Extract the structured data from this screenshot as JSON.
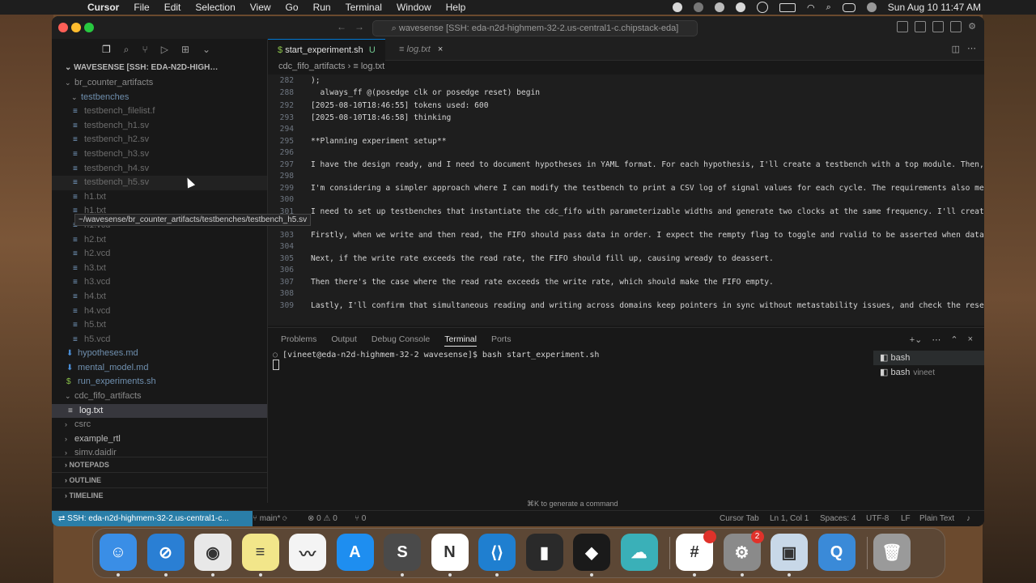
{
  "menubar": {
    "app": "Cursor",
    "items": [
      "File",
      "Edit",
      "Selection",
      "View",
      "Go",
      "Run",
      "Terminal",
      "Window",
      "Help"
    ],
    "clock": "Sun Aug 10  11:47 AM"
  },
  "window": {
    "command_center": "wavesense [SSH: eda-n2d-highmem-32-2.us-central1-c.chipstack-eda]"
  },
  "sidebar": {
    "header": "WAVESENSE [SSH: EDA-N2D-HIGH…",
    "tree": [
      {
        "label": "br_counter_artifacts",
        "type": "folder",
        "depth": 1,
        "open": true
      },
      {
        "label": "testbenches",
        "type": "folder",
        "depth": 2,
        "open": true
      },
      {
        "label": "testbench_filelist.f",
        "type": "file",
        "depth": 3
      },
      {
        "label": "testbench_h1.sv",
        "type": "file",
        "depth": 3
      },
      {
        "label": "testbench_h2.sv",
        "type": "file",
        "depth": 3
      },
      {
        "label": "testbench_h3.sv",
        "type": "file",
        "depth": 3
      },
      {
        "label": "testbench_h4.sv",
        "type": "file",
        "depth": 3
      },
      {
        "label": "testbench_h5.sv",
        "type": "file",
        "depth": 3
      },
      {
        "label": "h1.txt",
        "type": "file",
        "depth": 3
      },
      {
        "label": "h1.txt",
        "type": "file",
        "depth": 3
      },
      {
        "label": "h1.vcd",
        "type": "file",
        "depth": 3
      },
      {
        "label": "h2.txt",
        "type": "file",
        "depth": 3
      },
      {
        "label": "h2.vcd",
        "type": "file",
        "depth": 3
      },
      {
        "label": "h3.txt",
        "type": "file",
        "depth": 3
      },
      {
        "label": "h3.vcd",
        "type": "file",
        "depth": 3
      },
      {
        "label": "h4.txt",
        "type": "file",
        "depth": 3
      },
      {
        "label": "h4.vcd",
        "type": "file",
        "depth": 3
      },
      {
        "label": "h5.txt",
        "type": "file",
        "depth": 3
      },
      {
        "label": "h5.vcd",
        "type": "file",
        "depth": 3
      },
      {
        "label": "hypotheses.md",
        "type": "md",
        "depth": 2
      },
      {
        "label": "mental_model.md",
        "type": "md",
        "depth": 2
      },
      {
        "label": "run_experiments.sh",
        "type": "sh",
        "depth": 2
      },
      {
        "label": "cdc_fifo_artifacts",
        "type": "folder",
        "depth": 1,
        "open": true
      },
      {
        "label": "log.txt",
        "type": "file",
        "depth": 2,
        "selected": true
      },
      {
        "label": "csrc",
        "type": "folder",
        "depth": 1
      },
      {
        "label": "example_rtl",
        "type": "folder",
        "depth": 1
      },
      {
        "label": "simv.daidir",
        "type": "folder",
        "depth": 1
      }
    ],
    "tooltip": "~/wavesense/br_counter_artifacts/testbenches/testbench_h5.sv",
    "sections": [
      "NOTEPADS",
      "OUTLINE",
      "TIMELINE"
    ]
  },
  "tabs": [
    {
      "label": "start_experiment.sh",
      "status": "U"
    },
    {
      "label": "log.txt"
    }
  ],
  "breadcrumb": [
    "cdc_fifo_artifacts",
    "log.txt"
  ],
  "editor": {
    "lines": [
      {
        "n": "282",
        "text": ");"
      },
      {
        "n": "288",
        "text": "  always_ff @(posedge clk or posedge reset) begin"
      },
      {
        "n": "292",
        "text": "[2025-08-10T18:46:55] tokens used: 600"
      },
      {
        "n": "293",
        "text": "[2025-08-10T18:46:58] thinking"
      },
      {
        "n": "294",
        "text": ""
      },
      {
        "n": "295",
        "text": "**Planning experiment setup**"
      },
      {
        "n": "296",
        "text": ""
      },
      {
        "n": "297",
        "text": "I have the design ready, and I need to document hypotheses in YAML format. For each hypothesis, I'll create a testbench with a top module. Then, I"
      },
      {
        "n": "298",
        "text": ""
      },
      {
        "n": "299",
        "text": "I'm considering a simpler approach where I can modify the testbench to print a CSV log of signal values for each cycle. The requirements also me"
      },
      {
        "n": "300",
        "text": ""
      },
      {
        "n": "301",
        "text": "I need to set up testbenches that instantiate the cdc_fifo with parameterizable widths and generate two clocks at the same frequency. I'll creat"
      },
      {
        "n": "302",
        "text": ""
      },
      {
        "n": "303",
        "text": "Firstly, when we write and then read, the FIFO should pass data in order. I expect the rempty flag to toggle and rvalid to be asserted when data"
      },
      {
        "n": "304",
        "text": ""
      },
      {
        "n": "305",
        "text": "Next, if the write rate exceeds the read rate, the FIFO should fill up, causing wready to deassert."
      },
      {
        "n": "306",
        "text": ""
      },
      {
        "n": "307",
        "text": "Then there's the case where the read rate exceeds the write rate, which should make the FIFO empty."
      },
      {
        "n": "308",
        "text": ""
      },
      {
        "n": "309",
        "text": "Lastly, I'll confirm that simultaneous reading and writing across domains keep pointers in sync without metastability issues, and check the rese"
      }
    ]
  },
  "panel": {
    "tabs": [
      "Problems",
      "Output",
      "Debug Console",
      "Terminal",
      "Ports"
    ],
    "active_tab": "Terminal",
    "prompt": "[vineet@eda-n2d-highmem-32-2 wavesense]$ bash start_experiment.sh",
    "terminals": [
      {
        "label": "bash",
        "sub": ""
      },
      {
        "label": "bash",
        "sub": "vineet"
      }
    ],
    "hint": "⌘K to generate a command"
  },
  "statusbar": {
    "remote": "SSH: eda-n2d-highmem-32-2.us-central1-c...",
    "branch": "main*",
    "errors": "0",
    "warnings": "0",
    "ports": "0",
    "cursor_tab": "Cursor Tab",
    "position": "Ln 1, Col 1",
    "spaces": "Spaces: 4",
    "encoding": "UTF-8",
    "eol": "LF",
    "language": "Plain Text"
  },
  "dock": {
    "apps": [
      {
        "name": "Finder",
        "color": "#3a8ee6",
        "glyph": "☺"
      },
      {
        "name": "Safari",
        "color": "#2a7fd4",
        "glyph": "⊘"
      },
      {
        "name": "Chrome",
        "color": "#e8e8e8",
        "glyph": "◉"
      },
      {
        "name": "Notes",
        "color": "#f2e68a",
        "glyph": "≡"
      },
      {
        "name": "Freeform",
        "color": "#f4f4f4",
        "glyph": "〰"
      },
      {
        "name": "App Store",
        "color": "#1e8ef0",
        "glyph": "A"
      },
      {
        "name": "Sublime Text",
        "color": "#4a4a4a",
        "glyph": "S"
      },
      {
        "name": "Notion",
        "color": "#ffffff",
        "glyph": "N"
      },
      {
        "name": "VS Code",
        "color": "#1f7fd0",
        "glyph": "⟨⟩"
      },
      {
        "name": "Audio",
        "color": "#2a2a2a",
        "glyph": "▮"
      },
      {
        "name": "Cursor",
        "color": "#1a1a1a",
        "glyph": "◆"
      },
      {
        "name": "Cloud",
        "color": "#3ab0b8",
        "glyph": "☁"
      },
      {
        "name": "Slack",
        "color": "#ffffff",
        "glyph": "#",
        "badge": ""
      },
      {
        "name": "System Settings",
        "color": "#8a8a8a",
        "glyph": "⚙",
        "badge": "2"
      },
      {
        "name": "Preview",
        "color": "#c8d8e8",
        "glyph": "▣"
      },
      {
        "name": "QuickTime",
        "color": "#3a8ad8",
        "glyph": "Q"
      },
      {
        "name": "Trash",
        "color": "#9a9a9a",
        "glyph": "🗑"
      }
    ]
  }
}
